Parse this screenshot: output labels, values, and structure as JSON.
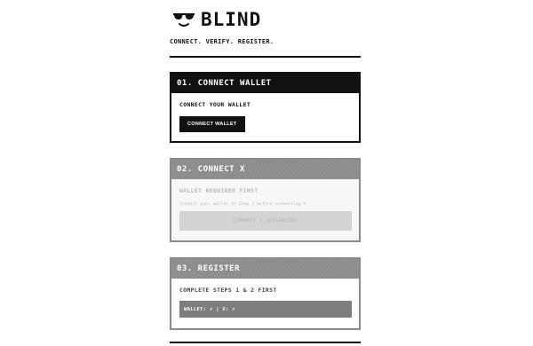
{
  "header": {
    "brand": "BLIND",
    "tagline": "CONNECT. VERIFY. REGISTER.",
    "logo_icon": "sunglasses-smile-icon"
  },
  "steps": [
    {
      "title": "01. CONNECT WALLET",
      "label": "CONNECT YOUR WALLET",
      "button_label": "CONNECT WALLET",
      "state": "active"
    },
    {
      "title": "02. CONNECT X",
      "label": "WALLET REQUIRED FIRST",
      "hint": "Connect your wallet in Step 1 before connecting X",
      "button_label": "CONNECT X (DISABLED)",
      "state": "disabled"
    },
    {
      "title": "03. REGISTER",
      "label": "COMPLETE STEPS 1 & 2 FIRST",
      "wallet_text": "WALLET: ✗ | X: ✗",
      "state": "disabled"
    }
  ],
  "colors": {
    "primary": "#111111",
    "disabled_header": "#8c8c8c",
    "disabled_button": "#d3d3d3",
    "background": "#ffffff"
  }
}
